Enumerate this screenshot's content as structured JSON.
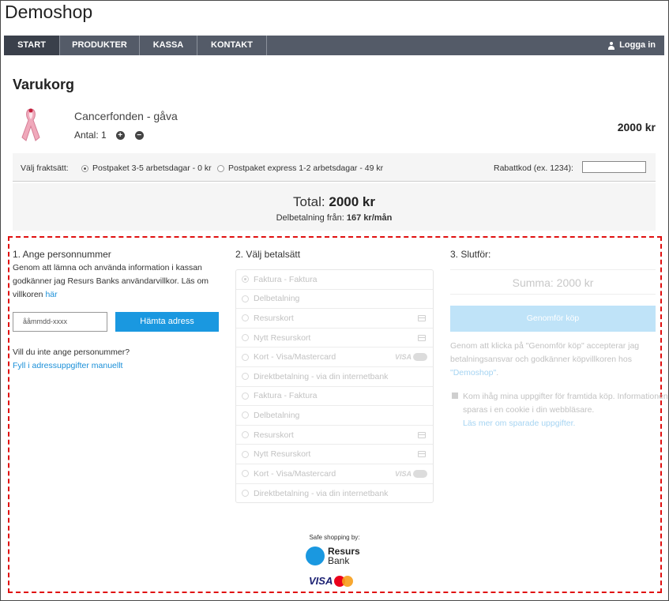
{
  "shop": {
    "title": "Demoshop"
  },
  "nav": {
    "items": [
      "START",
      "PRODUKTER",
      "KASSA",
      "KONTAKT"
    ],
    "login": "Logga in"
  },
  "cart": {
    "title": "Varukorg",
    "product_name": "Cancerfonden - gåva",
    "qty_label": "Antal: 1",
    "price": "2000 kr",
    "shipping_label": "Välj fraktsätt:",
    "shipping_options": [
      {
        "label": "Postpaket 3-5 arbetsdagar - 0 kr",
        "selected": true
      },
      {
        "label": "Postpaket express 1-2 arbetsdagar - 49 kr",
        "selected": false
      }
    ],
    "discount_label": "Rabattkod (ex. 1234):",
    "total_prefix": "Total:",
    "total_value": "2000 kr",
    "part_payment_prefix": "Delbetalning från:",
    "part_payment_value": "167 kr/mån"
  },
  "step1": {
    "title": "1. Ange personnummer",
    "text_line1": "Genom att lämna och använda information i kassan",
    "text_line2": "godkänner jag Resurs Banks användarvillkor. Läs om",
    "text_line3": "villkoren",
    "link_here": "här",
    "input_placeholder": "ååmmdd-xxxx",
    "fetch_button": "Hämta adress",
    "no_pnr_question": "Vill du inte ange personummer?",
    "manual_link": "Fyll i adressuppgifter manuellt"
  },
  "step2": {
    "title": "2. Välj betalsätt",
    "methods": [
      {
        "label": "Faktura - Faktura",
        "icon": "none",
        "selected": true
      },
      {
        "label": "Delbetalning",
        "icon": "none",
        "selected": false
      },
      {
        "label": "Resurskort",
        "icon": "card-icon",
        "selected": false
      },
      {
        "label": "Nytt Resurskort",
        "icon": "card-icon",
        "selected": false
      },
      {
        "label": "Kort - Visa/Mastercard",
        "icon": "visa-mastercard",
        "selected": false
      },
      {
        "label": "Direktbetalning - via din internetbank",
        "icon": "none",
        "selected": false
      },
      {
        "label": "Faktura - Faktura",
        "icon": "none",
        "selected": false
      },
      {
        "label": "Delbetalning",
        "icon": "none",
        "selected": false
      },
      {
        "label": "Resurskort",
        "icon": "card-icon",
        "selected": false
      },
      {
        "label": "Nytt Resurskort",
        "icon": "card-icon",
        "selected": false
      },
      {
        "label": "Kort - Visa/Mastercard",
        "icon": "visa-mastercard",
        "selected": false
      },
      {
        "label": "Direktbetalning - via din internetbank",
        "icon": "none",
        "selected": false
      }
    ],
    "visa_text": "VISA"
  },
  "step3": {
    "title": "3. Slutför:",
    "summa": "Summa: 2000 kr",
    "buy_button": "Genomför köp",
    "terms_line1": "Genom att klicka på \"Genomför köp\" accepterar jag",
    "terms_line2": "betalningsansvar och godkänner köpvillkoren hos",
    "terms_link": "\"Demoshop\"",
    "terms_end": ".",
    "remember_line1": "Kom ihåg mina uppgifter för framtida köp. Informationen",
    "remember_line2": "sparas i en cookie i din webbläsare.",
    "remember_link": "Läs mer om sparade uppgifter."
  },
  "footer": {
    "safe_label": "Safe shopping by:",
    "resurs_line1": "Resurs",
    "resurs_line2": "Bank",
    "visa_text": "VISA"
  },
  "colors": {
    "nav_bg": "#545b68",
    "nav_active": "#3a404b",
    "accent_blue": "#1a98e0",
    "dashed_border": "#e01010"
  }
}
